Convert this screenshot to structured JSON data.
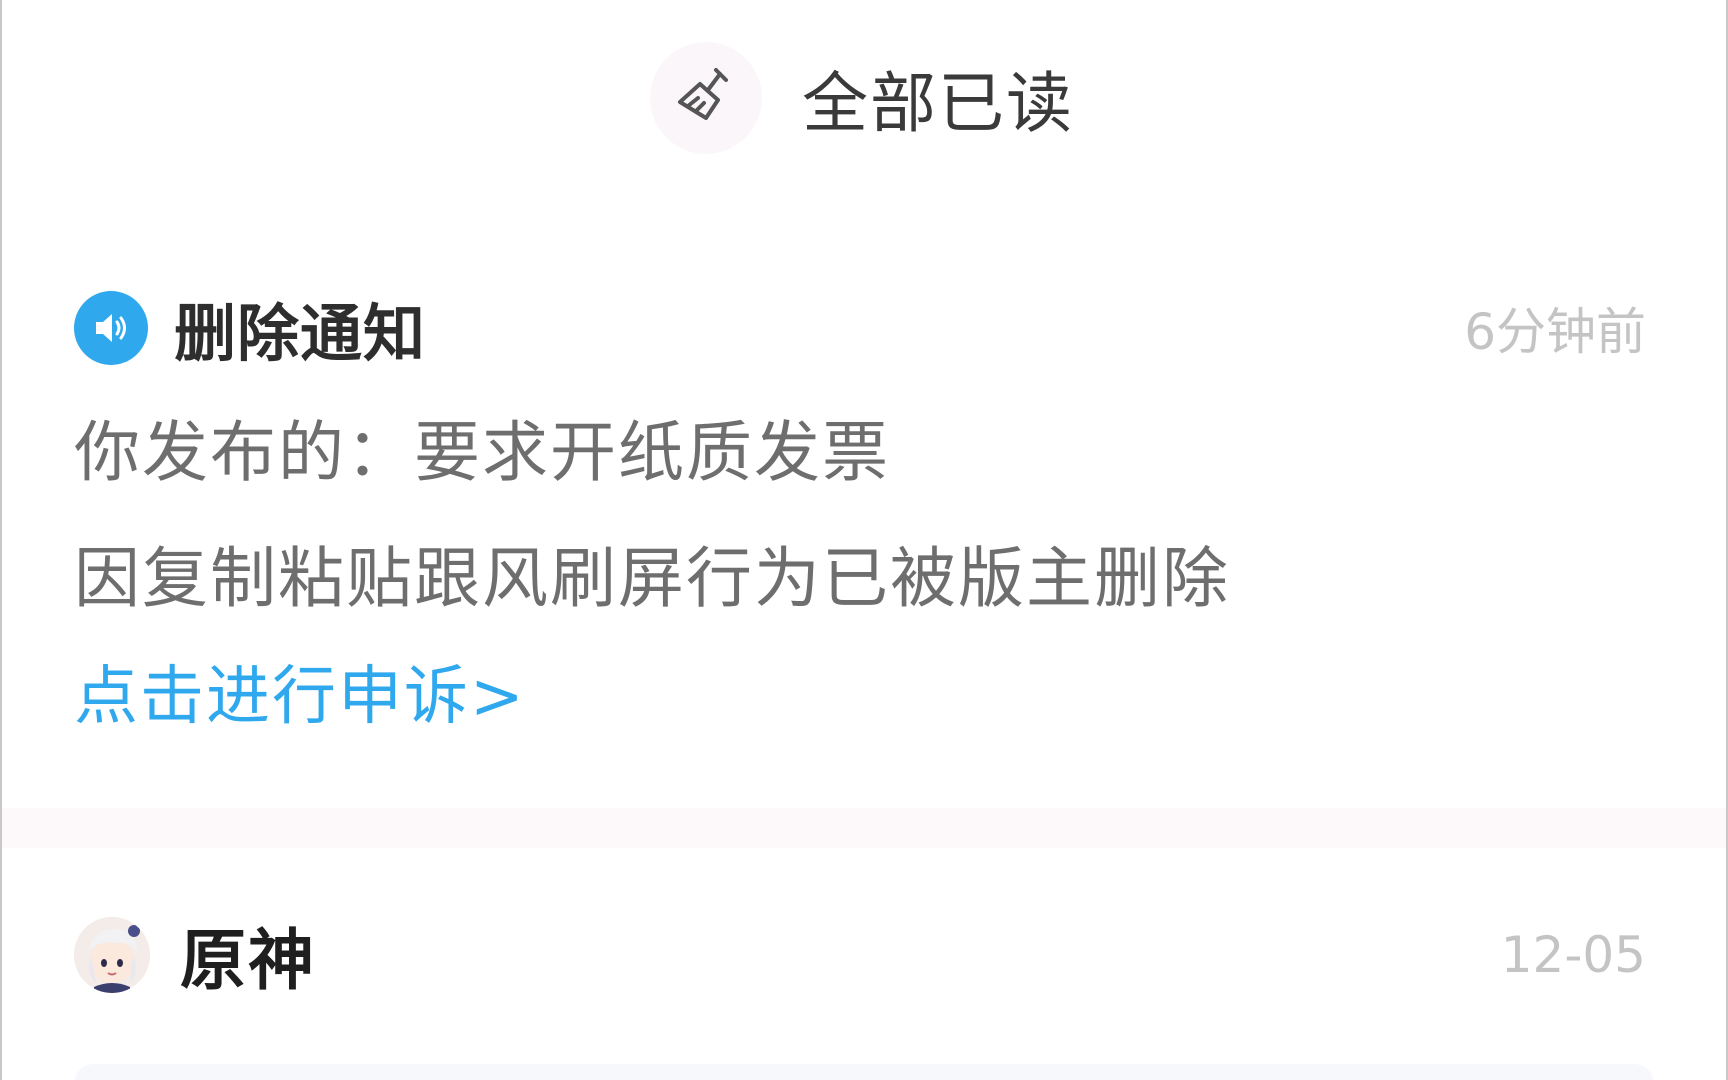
{
  "mark_all_read": {
    "icon": "broom-icon",
    "label": "全部已读"
  },
  "notices": [
    {
      "icon": "speaker-icon",
      "icon_color": "#2fa8ee",
      "title": "删除通知",
      "time": "6分钟前",
      "lines": [
        "你发布的：要求开纸质发票",
        "因复制粘贴跟风刷屏行为已被版主删除"
      ],
      "link_label": "点击进行申诉>"
    }
  ],
  "items": [
    {
      "avatar": "genshin-avatar",
      "title": "原神",
      "date": "12-05"
    }
  ],
  "colors": {
    "accent": "#2fa8ee",
    "time_text": "#c4c4c4",
    "body_text": "#6e6e6e"
  }
}
